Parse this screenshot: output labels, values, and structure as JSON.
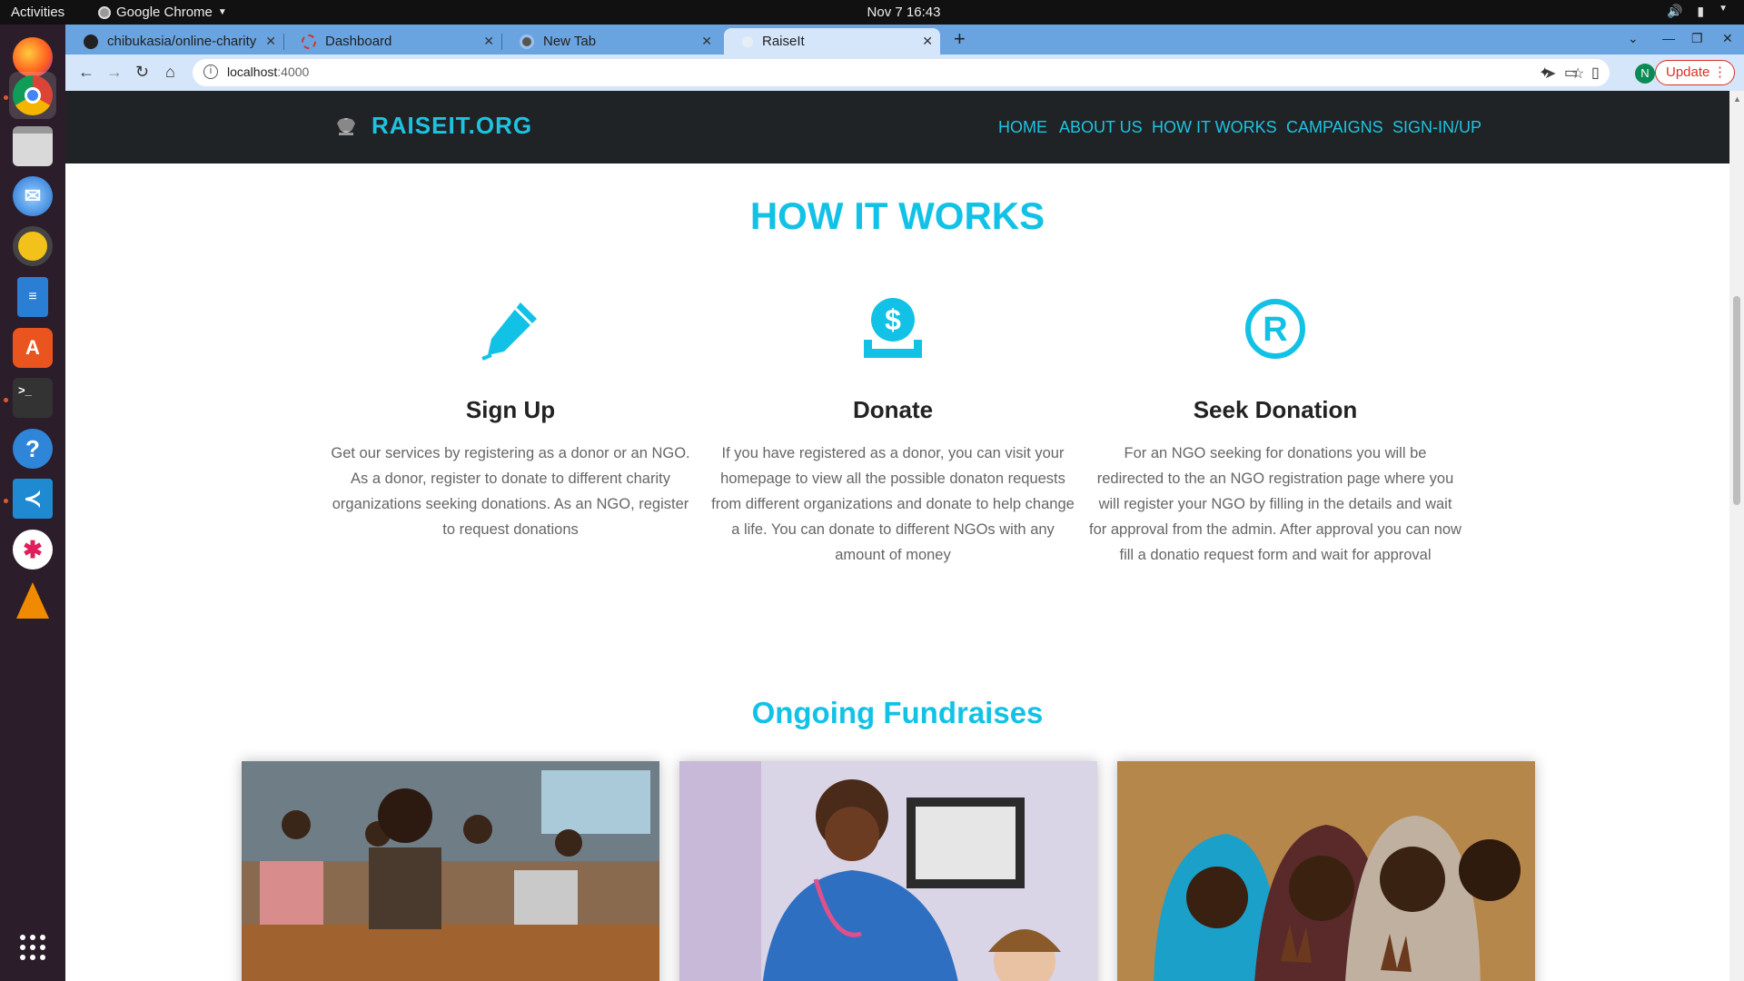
{
  "os": {
    "activities": "Activities",
    "app_name": "Google Chrome",
    "clock": "Nov 7  16:43"
  },
  "browser": {
    "tabs": [
      {
        "label": "chibukasia/online-charity"
      },
      {
        "label": "Dashboard"
      },
      {
        "label": "New Tab"
      },
      {
        "label": "RaiseIt"
      }
    ],
    "url_host": "localhost",
    "url_port": ":4000",
    "update_label": "Update"
  },
  "site": {
    "brand": "RAISEIT.ORG",
    "nav": [
      "HOME",
      "ABOUT US",
      "HOW IT WORKS",
      "CAMPAIGNS",
      "SIGN-IN/UP"
    ],
    "how_it_works_title": "HOW IT WORKS",
    "features": [
      {
        "title": "Sign Up",
        "text": "Get our services by registering as a donor or an NGO. As a donor, register to donate to different charity organizations seeking donations. As an NGO, register to request donations"
      },
      {
        "title": "Donate",
        "text": "If you have registered as a donor, you can visit your homepage to view all the possible donaton requests from different organizations and donate to help change a life. You can donate to different NGOs with any amount of money"
      },
      {
        "title": "Seek Donation",
        "text": "For an NGO seeking for donations you will be redirected to the an NGO registration page where you will register your NGO by filling in the details and wait for approval from the admin. After approval you can now fill a donatio request form and wait for approval"
      }
    ],
    "fundraises_title": "Ongoing Fundraises"
  },
  "colors": {
    "accent": "#12c2e6",
    "nav_bg": "#1f2326",
    "tab_strip": "#6aa4e0"
  }
}
